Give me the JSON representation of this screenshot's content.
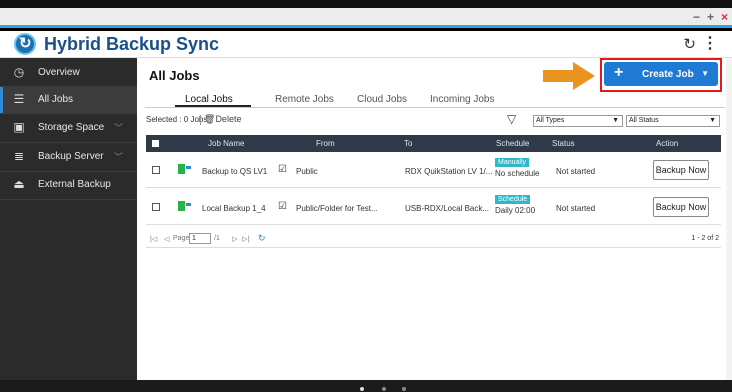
{
  "window": {
    "controls": {
      "minimize": "−",
      "maximize": "+",
      "close": "×"
    }
  },
  "app": {
    "title": "Hybrid Backup Sync",
    "logo_icon": "hbs-logo-icon",
    "header_icons": [
      "refresh-icon",
      "more-icon"
    ]
  },
  "sidebar": {
    "items": [
      {
        "label": "Overview",
        "icon": "overview-gauge-icon",
        "active": false,
        "chevron": false
      },
      {
        "label": "All Jobs",
        "icon": "list-icon",
        "active": true,
        "chevron": false
      },
      {
        "label": "Storage Space",
        "icon": "storage-icon",
        "active": false,
        "chevron": true
      },
      {
        "label": "Backup Server",
        "icon": "server-icon",
        "active": false,
        "chevron": true
      },
      {
        "label": "External Backup",
        "icon": "external-drive-icon",
        "active": false,
        "chevron": false
      }
    ]
  },
  "main": {
    "title": "All Jobs",
    "create_button": {
      "label": "Create Job",
      "plus": "+",
      "dropdown": "▼"
    },
    "tabs": [
      {
        "label": "Local Jobs",
        "active": true
      },
      {
        "label": "Remote Jobs",
        "active": false
      },
      {
        "label": "Cloud Jobs",
        "active": false
      },
      {
        "label": "Incoming Jobs",
        "active": false
      }
    ],
    "toolbar": {
      "selected": "Selected : 0 Jobs",
      "delete_label": "Delete",
      "type_filter": "All Types",
      "status_filter": "All Status"
    },
    "columns": [
      "Job Name",
      "From",
      "To",
      "Schedule",
      "Status",
      "Action"
    ],
    "rows": [
      {
        "name": "Backup to QS LV1",
        "from": "Public",
        "to": "RDX QuikStation LV 1/...",
        "schedule_badge": "Manually",
        "schedule_text": "No schedule",
        "status": "Not started",
        "action": "Backup Now"
      },
      {
        "name": "Local Backup 1_4",
        "from": "Public/Folder for Test...",
        "to": "USB-RDX/Local Back...",
        "schedule_badge": "Schedule",
        "schedule_text": "Daily 02:00",
        "status": "Not started",
        "action": "Backup Now"
      }
    ],
    "pager": {
      "page_label": "Page",
      "page_value": "1",
      "of_label": "/1",
      "range": "1 - 2 of 2"
    }
  },
  "colors": {
    "accent_blue": "#1f7ad6",
    "highlight_red": "#e5171b",
    "arrow_orange": "#e8941e",
    "sidebar_bg": "#2b2b2b",
    "grid_header_bg": "#2e3a4a",
    "badge_teal": "#2eb8c9"
  }
}
